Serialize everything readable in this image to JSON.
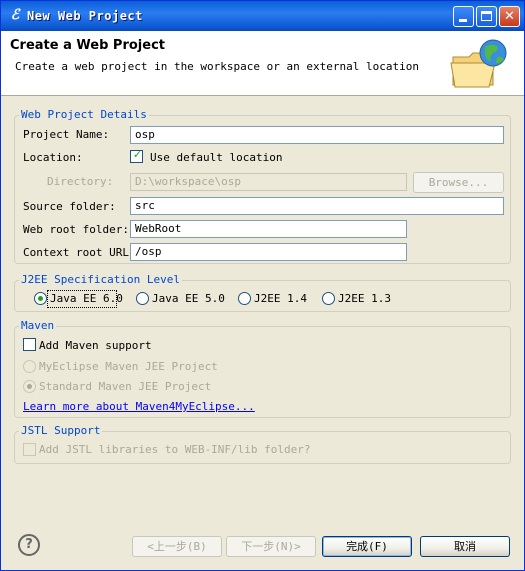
{
  "window": {
    "title": "New Web Project",
    "icon": "myeclipse-icon",
    "controls": {
      "minimize": "minimize-icon",
      "maximize": "maximize-icon",
      "close": "close-icon"
    }
  },
  "header": {
    "title": "Create a Web Project",
    "description": "Create a web project in the workspace or an external location",
    "icon": "globe-folder-icon"
  },
  "details": {
    "group_label": "Web Project Details",
    "project_name_label": "Project Name:",
    "project_name_value": "osp",
    "location_label": "Location:",
    "use_default_location_label": "Use default location",
    "use_default_location_checked": true,
    "directory_label": "Directory:",
    "directory_value": "D:\\workspace\\osp",
    "browse_label": "Browse...",
    "source_folder_label": "Source folder:",
    "source_folder_value": "src",
    "web_root_folder_label": "Web root folder:",
    "web_root_folder_value": "WebRoot",
    "context_root_label": "Context root URL:",
    "context_root_value": "/osp"
  },
  "j2ee": {
    "group_label": "J2EE Specification Level",
    "options": [
      "Java EE 6.0",
      "Java EE 5.0",
      "J2EE 1.4",
      "J2EE 1.3"
    ],
    "selected": "Java EE 6.0"
  },
  "maven": {
    "group_label": "Maven",
    "add_support_label": "Add Maven support",
    "add_support_checked": false,
    "options": [
      "MyEclipse Maven JEE Project",
      "Standard Maven JEE Project"
    ],
    "selected": "Standard Maven JEE Project",
    "learn_more_link": "Learn more about Maven4MyEclipse..."
  },
  "jstl": {
    "group_label": "JSTL Support",
    "add_libraries_label": "Add JSTL libraries to WEB-INF/lib folder?",
    "add_libraries_checked": false
  },
  "footer": {
    "help_icon": "help-icon",
    "back_label": "<上一步(B)",
    "next_label": "下一步(N)>",
    "finish_label": "完成(F)",
    "cancel_label": "取消"
  },
  "colors": {
    "titlebar": "#0a5fd8",
    "group_label": "#0046d5",
    "link": "#0000ff",
    "check_mark": "#21a121"
  }
}
